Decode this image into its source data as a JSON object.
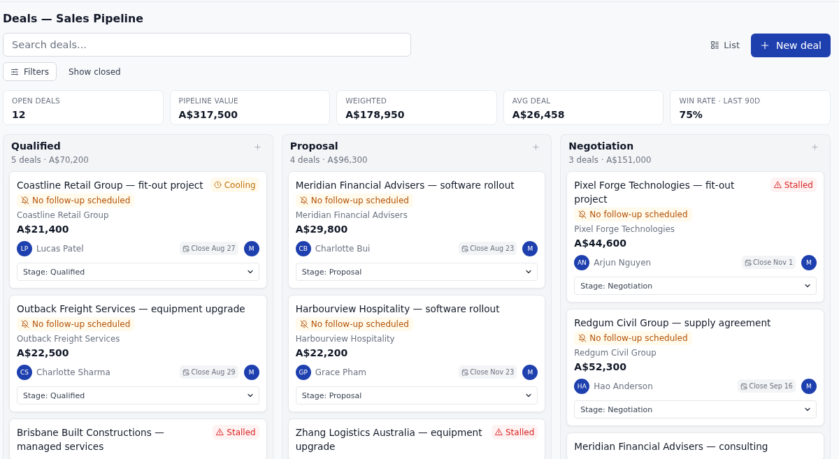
{
  "page": {
    "title": "Deals — Sales Pipeline"
  },
  "search": {
    "placeholder": "Search deals..."
  },
  "actions": {
    "view_toggle": "List",
    "new_deal": "New deal"
  },
  "filters": {
    "filters_button": "Filters",
    "show_closed": "Show closed"
  },
  "stats": [
    {
      "label": "OPEN DEALS",
      "value": "12"
    },
    {
      "label": "PIPELINE VALUE",
      "value": "A$317,500"
    },
    {
      "label": "WEIGHTED",
      "value": "A$178,950"
    },
    {
      "label": "AVG DEAL",
      "value": "A$26,458"
    },
    {
      "label": "WIN RATE · LAST 90D",
      "value": "75%"
    }
  ],
  "columns": [
    {
      "name": "Qualified",
      "summary": "5 deals · A$70,200",
      "cards": [
        {
          "title": "Coastline Retail Group — fit-out project",
          "flag": {
            "kind": "cooling",
            "label": "Cooling"
          },
          "follow_up": "No follow-up scheduled",
          "company": "Coastline Retail Group",
          "amount": "A$21,400",
          "owner": {
            "initials": "LP",
            "name": "Lucas Patel"
          },
          "close": "Close Aug 27",
          "assignee": "M",
          "stage": "Stage: Qualified"
        },
        {
          "title": "Outback Freight Services — equipment upgrade",
          "follow_up": "No follow-up scheduled",
          "company": "Outback Freight Services",
          "amount": "A$22,500",
          "owner": {
            "initials": "CS",
            "name": "Charlotte Sharma"
          },
          "close": "Close Aug 29",
          "assignee": "M",
          "stage": "Stage: Qualified"
        },
        {
          "title": "Brisbane Built Constructions — managed services",
          "flag": {
            "kind": "stalled",
            "label": "Stalled"
          }
        }
      ]
    },
    {
      "name": "Proposal",
      "summary": "4 deals · A$96,300",
      "cards": [
        {
          "title": "Meridian Financial Advisers — software rollout",
          "follow_up": "No follow-up scheduled",
          "company": "Meridian Financial Advisers",
          "amount": "A$29,800",
          "owner": {
            "initials": "CB",
            "name": "Charlotte Bui"
          },
          "close": "Close Aug 23",
          "assignee": "M",
          "stage": "Stage: Proposal"
        },
        {
          "title": "Harbourview Hospitality — software rollout",
          "follow_up": "No follow-up scheduled",
          "company": "Harbourview Hospitality",
          "amount": "A$22,200",
          "owner": {
            "initials": "GP",
            "name": "Grace Pham"
          },
          "close": "Close Nov 23",
          "assignee": "M",
          "stage": "Stage: Proposal"
        },
        {
          "title": "Zhang Logistics Australia — equipment upgrade",
          "flag": {
            "kind": "stalled",
            "label": "Stalled"
          }
        }
      ]
    },
    {
      "name": "Negotiation",
      "summary": "3 deals · A$151,000",
      "cards": [
        {
          "title": "Pixel Forge Technologies — fit-out project",
          "flag": {
            "kind": "stalled",
            "label": "Stalled"
          },
          "follow_up": "No follow-up scheduled",
          "company": "Pixel Forge Technologies",
          "amount": "A$44,600",
          "owner": {
            "initials": "AN",
            "name": "Arjun Nguyen"
          },
          "close": "Close Nov 1",
          "assignee": "M",
          "stage": "Stage: Negotiation"
        },
        {
          "title": "Redgum Civil Group — supply agreement",
          "follow_up": "No follow-up scheduled",
          "company": "Redgum Civil Group",
          "amount": "A$52,300",
          "owner": {
            "initials": "HA",
            "name": "Hao Anderson"
          },
          "close": "Close Sep 16",
          "assignee": "M",
          "stage": "Stage: Negotiation"
        },
        {
          "title": "Meridian Financial Advisers — consulting"
        }
      ]
    }
  ]
}
